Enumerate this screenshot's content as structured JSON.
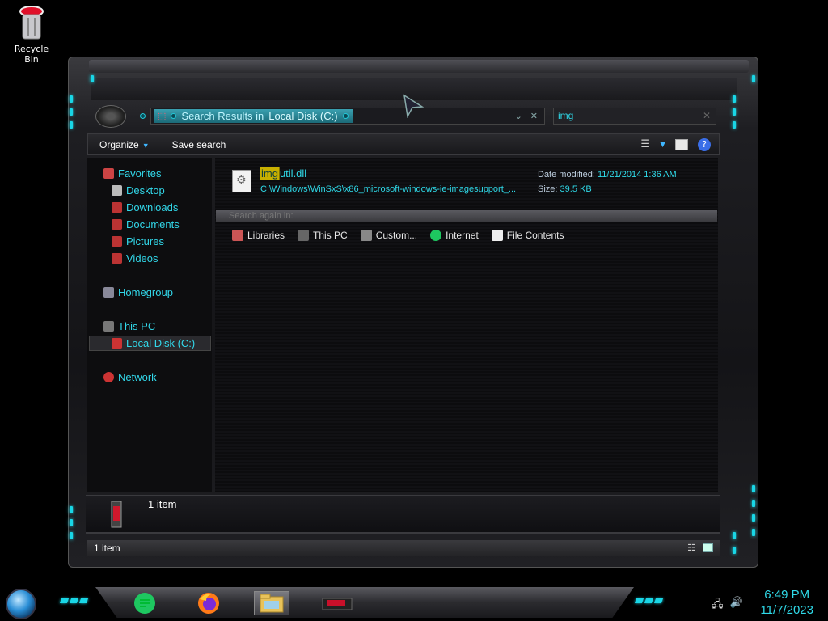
{
  "desktop": {
    "recycle_bin_label": "Recycle Bin"
  },
  "explorer": {
    "address": {
      "path_prefix": "Search Results in",
      "path_location": "Local Disk (C:)"
    },
    "search": {
      "query": "img"
    },
    "toolbar": {
      "organize_label": "Organize",
      "save_search_label": "Save search"
    },
    "nav": {
      "favorites": "Favorites",
      "desktop": "Desktop",
      "downloads": "Downloads",
      "documents": "Documents",
      "pictures": "Pictures",
      "videos": "Videos",
      "homegroup": "Homegroup",
      "this_pc": "This PC",
      "local_disk": "Local Disk (C:)",
      "network": "Network"
    },
    "result": {
      "name_match": "img",
      "name_rest": "util.dll",
      "path": "C:\\Windows\\WinSxS\\x86_microsoft-windows-ie-imagesupport_...",
      "date_label": "Date modified:",
      "date_value": "11/21/2014 1:36 AM",
      "size_label": "Size:",
      "size_value": "39.5 KB"
    },
    "search_again": {
      "label": "Search again in:",
      "links": [
        "Libraries",
        "This PC",
        "Custom...",
        "Internet",
        "File Contents"
      ]
    },
    "details": {
      "count": "1 item"
    },
    "status": {
      "count": "1 item"
    }
  },
  "taskbar": {
    "time": "6:49 PM",
    "date": "11/7/2023"
  },
  "colors": {
    "accent_cyan": "#2fd9e8",
    "highlight_match": "#c8b000"
  }
}
